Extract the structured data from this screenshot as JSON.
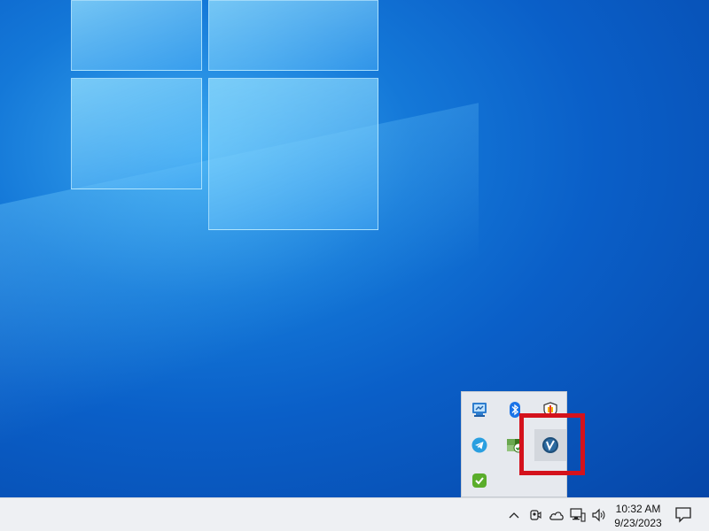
{
  "desktop": {
    "wallpaper": "windows-10-hero",
    "colors": {
      "deep": "#0646a8",
      "mid": "#1478d8",
      "light": "#3aa8f0"
    }
  },
  "tray_popup": {
    "icons": [
      {
        "name": "network-config-icon",
        "row": 0,
        "col": 0
      },
      {
        "name": "bluetooth-icon",
        "row": 0,
        "col": 1
      },
      {
        "name": "windows-security-icon",
        "row": 0,
        "col": 2
      },
      {
        "name": "telegram-icon",
        "row": 1,
        "col": 0
      },
      {
        "name": "sync-status-icon",
        "row": 1,
        "col": 1
      },
      {
        "name": "app-v-icon",
        "row": 1,
        "col": 2,
        "highlighted": true
      },
      {
        "name": "green-check-icon",
        "row": 2,
        "col": 0
      }
    ],
    "highlight_color": "#d4121c"
  },
  "taskbar": {
    "icons": [
      "chevron-up-icon",
      "meet-now-icon",
      "onedrive-icon",
      "network-icon",
      "volume-icon"
    ],
    "clock": {
      "time": "10:32 AM",
      "date": "9/23/2023"
    },
    "notification_icon": "action-center-icon"
  }
}
